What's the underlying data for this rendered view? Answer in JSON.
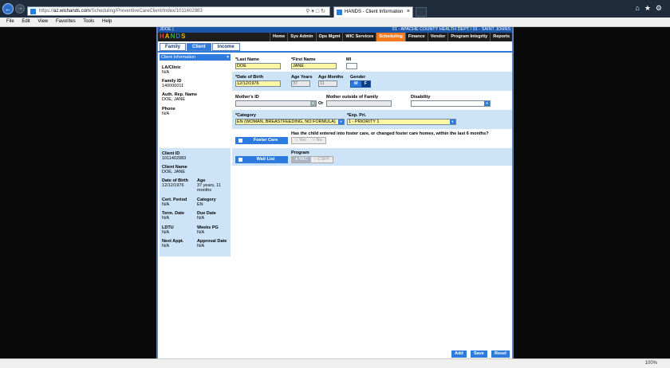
{
  "browser": {
    "url_prefix": "https://",
    "url_domain": "az.wichands.com",
    "url_path": "/Scheduling/PreventiveCareClient/Index/1011402983",
    "tab_title": "HANDS - Client Information",
    "menu": [
      "File",
      "Edit",
      "View",
      "Favorites",
      "Tools",
      "Help"
    ],
    "zoom": "100%"
  },
  "app": {
    "top_left": "JDOE | ",
    "top_right": "01 - APACHE COUNTY HEALTH DEPT / 01 - SAINT JOHNS",
    "logo": [
      "H",
      "A",
      "N",
      "D",
      "S"
    ],
    "nav": [
      {
        "label": "Home",
        "active": false
      },
      {
        "label": "Sys Admin",
        "active": false
      },
      {
        "label": "Ops Mgmt",
        "active": false
      },
      {
        "label": "WIC Services",
        "active": false
      },
      {
        "label": "Scheduling",
        "active": true
      },
      {
        "label": "Finance",
        "active": false
      },
      {
        "label": "Vendor",
        "active": false
      },
      {
        "label": "Program Integrity",
        "active": false
      },
      {
        "label": "Reports",
        "active": false
      }
    ],
    "subtabs": [
      {
        "label": "Family",
        "active": false
      },
      {
        "label": "Client",
        "active": true
      },
      {
        "label": "Income",
        "active": false
      }
    ]
  },
  "sidebar": {
    "header": "Client Information",
    "la_clinic_label": "LA/Clinic",
    "la_clinic_value": "N/A",
    "family_id_label": "Family ID",
    "family_id_value": "140000011",
    "auth_rep_label": "Auth. Rep. Name",
    "auth_rep_value": "DOE, JANE",
    "phone_label": "Phone",
    "phone_value": "N/A",
    "client_id_label": "Client ID",
    "client_id_value": "1011402983",
    "client_name_label": "Client Name",
    "client_name_value": "DOE, JANE",
    "dob_label": "Date of Birth",
    "dob_value": "12/12/1976",
    "age_label": "Age",
    "age_value": "37 years, 11 months",
    "cert_period_label": "Cert. Period",
    "cert_period_value": "N/A",
    "category_label": "Category",
    "category_value": "EN",
    "term_date_label": "Term. Date",
    "term_date_value": "N/A",
    "due_date_label": "Due Date",
    "due_date_value": "N/A",
    "ldtu_label": "LDTU",
    "ldtu_value": "N/A",
    "weeks_pg_label": "Weeks PG",
    "weeks_pg_value": "N/A",
    "next_appt_label": "Next Appt.",
    "next_appt_value": "N/A",
    "approval_date_label": "Approval Date",
    "approval_date_value": "N/A"
  },
  "form": {
    "last_name_label": "*Last Name",
    "last_name": "DOE",
    "first_name_label": "*First Name",
    "first_name": "JANE",
    "mi_label": "MI",
    "mi": "",
    "dob_label": "*Date of Birth",
    "dob": "12/12/1976",
    "age_years_label": "Age Years",
    "age_years": "37",
    "age_months_label": "Age Months",
    "age_months": "11",
    "gender_label": "Gender",
    "gender_m": "M",
    "gender_f": "F",
    "mothers_id_label": "Mother's ID",
    "mothers_id": "",
    "or_label": "Or",
    "mother_outside_label": "Mother outside of Family",
    "mother_outside": "",
    "disability_label": "Disability",
    "disability": "",
    "category_label": "*Category",
    "category": "EN (WOMAN, BREASTFEEDING, NO FORMULA)",
    "exp_pri_label": "*Exp. Pri.",
    "exp_pri": "1 - PRIORITY 1",
    "foster_question": "Has the child entered into foster care, or changed foster care homes, within the last 6 months?",
    "foster_care_label": "Foster Care",
    "yes_label": "Yes",
    "no_label": "No",
    "program_label": "Program",
    "wait_list_label": "Wait List",
    "wic_label": "WIC",
    "csfp_label": "CSFP"
  },
  "footer": {
    "add": "Add",
    "save": "Save",
    "reset": "Reset"
  }
}
